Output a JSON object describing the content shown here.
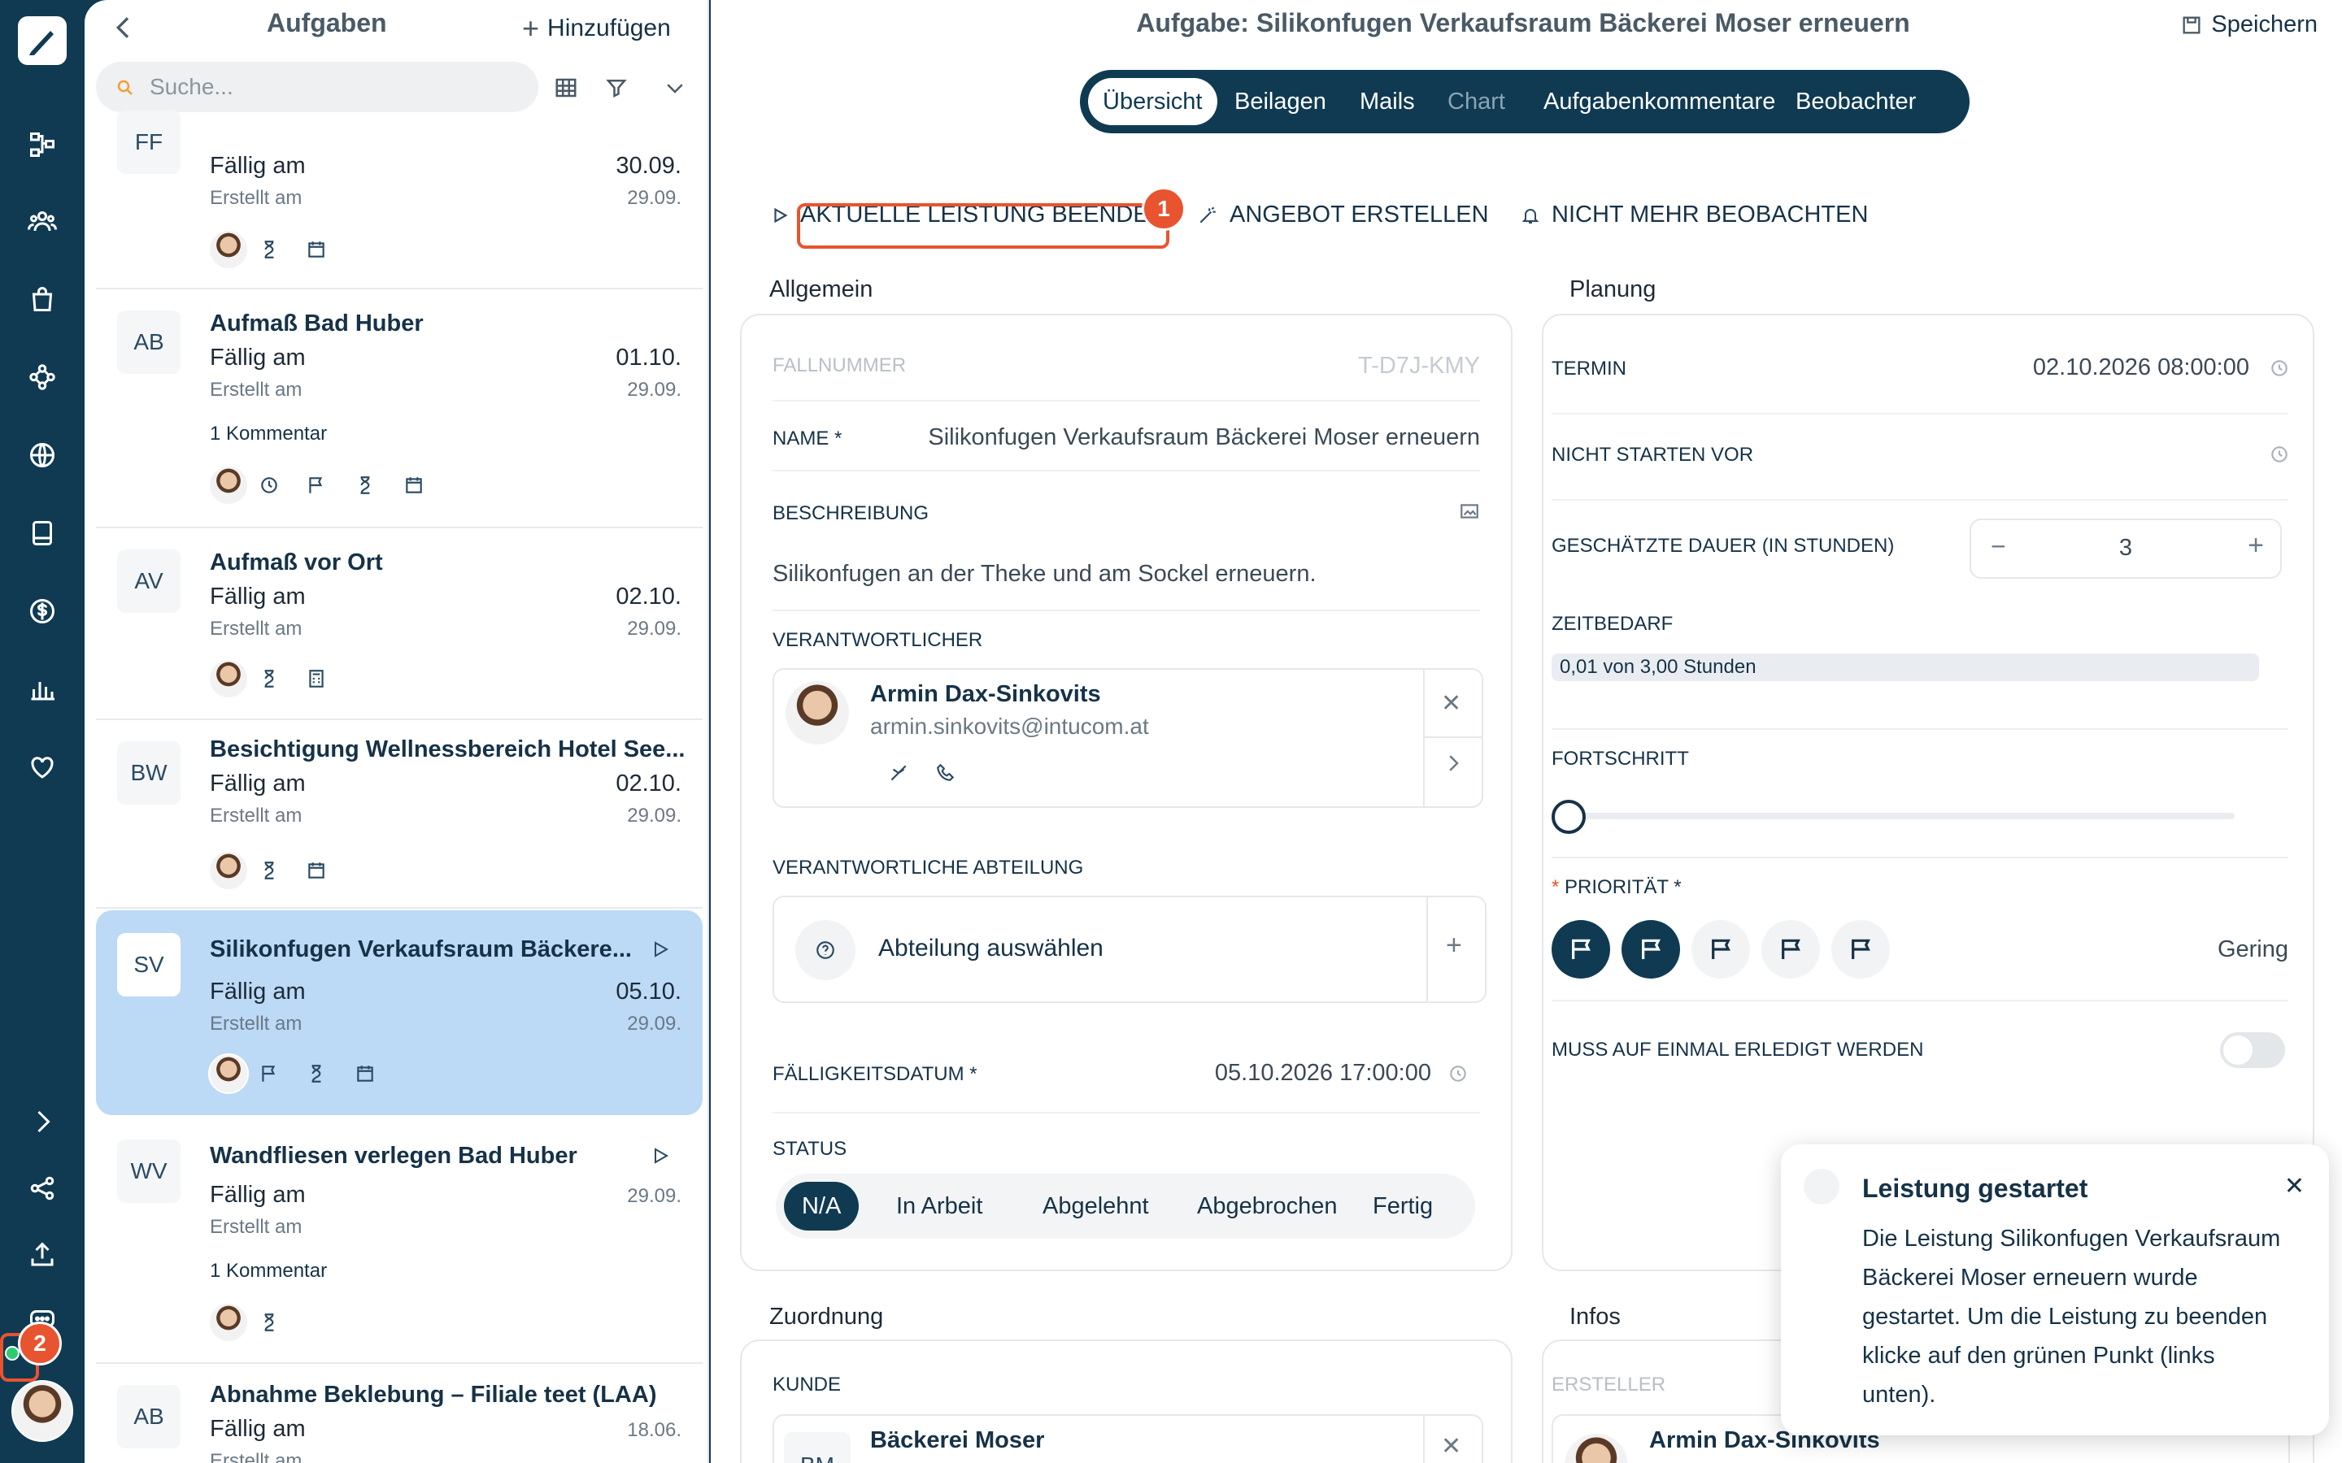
{
  "sidebar": {
    "icons": [
      "pen-icon",
      "workflow-icon",
      "users-icon",
      "bag-icon",
      "network-icon",
      "globe-icon",
      "book-icon",
      "dollar-icon",
      "bar-chart-icon",
      "heart-icon",
      "chevron-right-icon",
      "share-icon",
      "upload-icon",
      "chat-icon"
    ],
    "badge": "2"
  },
  "list": {
    "title": "Aufgaben",
    "add_label": "Hinzufügen",
    "search_placeholder": "Suche...",
    "cards": [
      {
        "initials": "FF",
        "title": "",
        "due_label": "Fällig am",
        "created_label": "Erstellt am",
        "due_date": "30.09.",
        "created_date": "29.09.",
        "comment": ""
      },
      {
        "initials": "AB",
        "title": "Aufmaß Bad Huber",
        "due_label": "Fällig am",
        "created_label": "Erstellt am",
        "due_date": "01.10.",
        "created_date": "29.09.",
        "comment": "1 Kommentar"
      },
      {
        "initials": "AV",
        "title": "Aufmaß vor Ort",
        "due_label": "Fällig am",
        "created_label": "Erstellt am",
        "due_date": "02.10.",
        "created_date": "29.09.",
        "comment": ""
      },
      {
        "initials": "BW",
        "title": "Besichtigung Wellnessbereich Hotel See...",
        "due_label": "Fällig am",
        "created_label": "Erstellt am",
        "due_date": "02.10.",
        "created_date": "29.09.",
        "comment": ""
      },
      {
        "initials": "SV",
        "title": "Silikonfugen Verkaufsraum Bäckere...",
        "due_label": "Fällig am",
        "created_label": "Erstellt am",
        "due_date": "05.10.",
        "created_date": "29.09.",
        "comment": ""
      },
      {
        "initials": "WV",
        "title": "Wandfliesen verlegen Bad Huber",
        "due_label": "Fällig am",
        "created_label": "Erstellt am",
        "due_date": "",
        "created_date": "29.09.",
        "comment": "1 Kommentar"
      },
      {
        "initials": "AB",
        "title": "Abnahme Beklebung – Filiale teet (LAA)",
        "due_label": "Fällig am",
        "created_label": "Erstellt am",
        "due_date": "18.06.",
        "created_date": "",
        "comment": ""
      }
    ]
  },
  "main": {
    "title": "Aufgabe: Silikonfugen Verkaufsraum Bäckerei Moser erneuern",
    "save_label": "Speichern",
    "tabs": [
      "Übersicht",
      "Beilagen",
      "Mails",
      "Chart",
      "Aufgabenkommentare",
      "Beobachter"
    ],
    "actions": {
      "end_service": "AKTUELLE LEISTUNG BEENDEN",
      "create_offer": "ANGEBOT ERSTELLEN",
      "unwatch": "NICHT MEHR BEOBACHTEN",
      "badge": "1"
    },
    "general": {
      "section": "Allgemein",
      "case_label": "FALLNUMMER",
      "case_value": "T-D7J-KMY",
      "name_label": "NAME *",
      "name_value": "Silikonfugen Verkaufsraum Bäckerei Moser erneuern",
      "desc_label": "BESCHREIBUNG",
      "desc_value": "Silikonfugen an der Theke und am Sockel erneuern.",
      "resp_label": "VERANTWORTLICHER",
      "resp_name": "Armin Dax-Sinkovits",
      "resp_email": "armin.sinkovits@intucom.at",
      "dept_label": "VERANTWORTLICHE ABTEILUNG",
      "dept_placeholder": "Abteilung auswählen",
      "due_label": "FÄLLIGKEITSDATUM *",
      "due_value": "05.10.2026 17:00:00",
      "status_label": "STATUS",
      "status_options": [
        "N/A",
        "In Arbeit",
        "Abgelehnt",
        "Abgebrochen",
        "Fertig"
      ]
    },
    "planning": {
      "section": "Planung",
      "term_label": "TERMIN",
      "term_value": "02.10.2026 08:00:00",
      "not_before_label": "NICHT STARTEN VOR",
      "duration_label": "GESCHÄTZTE DAUER (IN STUNDEN)",
      "duration_value": "3",
      "time_label": "ZEITBEDARF",
      "time_value": "0,01 von 3,00 Stunden",
      "progress_label": "FORTSCHRITT",
      "progress_value": 0,
      "priority_label": "PRIORITÄT *",
      "priority_required": "*",
      "priority_value": "Gering",
      "priority_level": 2,
      "once_label": "MUSS AUF EINMAL ERLEDIGT WERDEN",
      "once_on": false
    },
    "assignment": {
      "section": "Zuordnung",
      "customer_label": "KUNDE",
      "customer_initials": "BM",
      "customer_name": "Bäckerei Moser"
    },
    "infos": {
      "section": "Infos",
      "creator_label": "ERSTELLER",
      "creator_name": "Armin Dax-Sinkovits"
    },
    "toast": {
      "title": "Leistung gestartet",
      "body": "Die Leistung Silikonfugen Verkaufsraum Bäckerei Moser erneuern wurde gestartet. Um die Leistung zu beenden klicke auf den grünen Punkt (links unten)."
    }
  },
  "colors": {
    "navy": "#0f3a52",
    "selected": "#bcd9f6",
    "badge": "#e8542f",
    "status_green": "#2ecc71"
  }
}
